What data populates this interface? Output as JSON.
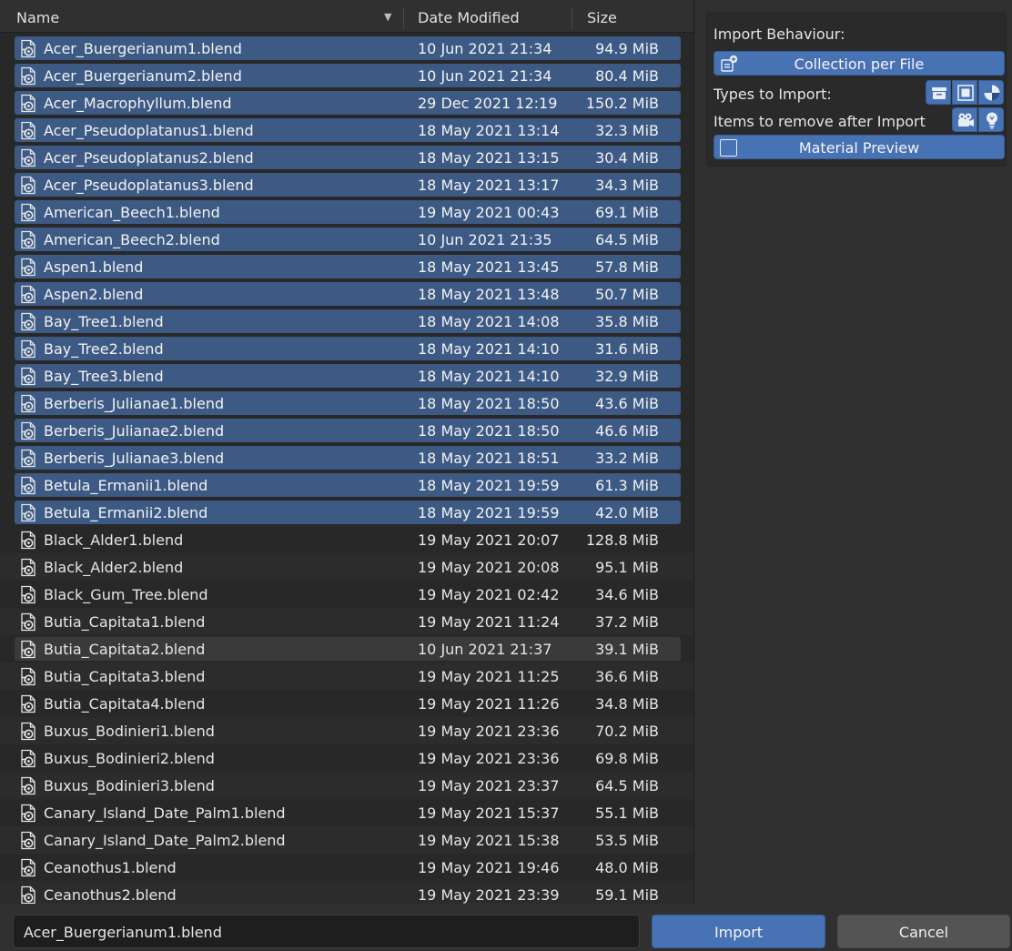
{
  "header": {
    "name_label": "Name",
    "sort_indicator": "▼",
    "date_label": "Date Modified",
    "size_label": "Size"
  },
  "files": [
    {
      "name": "Acer_Buergerianum1.blend",
      "date": "10 Jun 2021 21:34",
      "size": "94.9 MiB",
      "selected": true
    },
    {
      "name": "Acer_Buergerianum2.blend",
      "date": "10 Jun 2021 21:34",
      "size": "80.4 MiB",
      "selected": true
    },
    {
      "name": "Acer_Macrophyllum.blend",
      "date": "29 Dec 2021 12:19",
      "size": "150.2 MiB",
      "selected": true
    },
    {
      "name": "Acer_Pseudoplatanus1.blend",
      "date": "18 May 2021 13:14",
      "size": "32.3 MiB",
      "selected": true
    },
    {
      "name": "Acer_Pseudoplatanus2.blend",
      "date": "18 May 2021 13:15",
      "size": "30.4 MiB",
      "selected": true
    },
    {
      "name": "Acer_Pseudoplatanus3.blend",
      "date": "18 May 2021 13:17",
      "size": "34.3 MiB",
      "selected": true
    },
    {
      "name": "American_Beech1.blend",
      "date": "19 May 2021 00:43",
      "size": "69.1 MiB",
      "selected": true
    },
    {
      "name": "American_Beech2.blend",
      "date": "10 Jun 2021 21:35",
      "size": "64.5 MiB",
      "selected": true
    },
    {
      "name": "Aspen1.blend",
      "date": "18 May 2021 13:45",
      "size": "57.8 MiB",
      "selected": true
    },
    {
      "name": "Aspen2.blend",
      "date": "18 May 2021 13:48",
      "size": "50.7 MiB",
      "selected": true
    },
    {
      "name": "Bay_Tree1.blend",
      "date": "18 May 2021 14:08",
      "size": "35.8 MiB",
      "selected": true
    },
    {
      "name": "Bay_Tree2.blend",
      "date": "18 May 2021 14:10",
      "size": "31.6 MiB",
      "selected": true
    },
    {
      "name": "Bay_Tree3.blend",
      "date": "18 May 2021 14:10",
      "size": "32.9 MiB",
      "selected": true
    },
    {
      "name": "Berberis_Julianae1.blend",
      "date": "18 May 2021 18:50",
      "size": "43.6 MiB",
      "selected": true
    },
    {
      "name": "Berberis_Julianae2.blend",
      "date": "18 May 2021 18:50",
      "size": "46.6 MiB",
      "selected": true
    },
    {
      "name": "Berberis_Julianae3.blend",
      "date": "18 May 2021 18:51",
      "size": "33.2 MiB",
      "selected": true
    },
    {
      "name": "Betula_Ermanii1.blend",
      "date": "18 May 2021 19:59",
      "size": "61.3 MiB",
      "selected": true
    },
    {
      "name": "Betula_Ermanii2.blend",
      "date": "18 May 2021 19:59",
      "size": "42.0 MiB",
      "selected": true
    },
    {
      "name": "Black_Alder1.blend",
      "date": "19 May 2021 20:07",
      "size": "128.8 MiB",
      "selected": false
    },
    {
      "name": "Black_Alder2.blend",
      "date": "19 May 2021 20:08",
      "size": "95.1 MiB",
      "selected": false
    },
    {
      "name": "Black_Gum_Tree.blend",
      "date": "19 May 2021 02:42",
      "size": "34.6 MiB",
      "selected": false
    },
    {
      "name": "Butia_Capitata1.blend",
      "date": "19 May 2021 11:24",
      "size": "37.2 MiB",
      "selected": false
    },
    {
      "name": "Butia_Capitata2.blend",
      "date": "10 Jun 2021 21:37",
      "size": "39.1 MiB",
      "selected": false,
      "hover": true
    },
    {
      "name": "Butia_Capitata3.blend",
      "date": "19 May 2021 11:25",
      "size": "36.6 MiB",
      "selected": false
    },
    {
      "name": "Butia_Capitata4.blend",
      "date": "19 May 2021 11:26",
      "size": "34.8 MiB",
      "selected": false
    },
    {
      "name": "Buxus_Bodinieri1.blend",
      "date": "19 May 2021 23:36",
      "size": "70.2 MiB",
      "selected": false
    },
    {
      "name": "Buxus_Bodinieri2.blend",
      "date": "19 May 2021 23:36",
      "size": "69.8 MiB",
      "selected": false
    },
    {
      "name": "Buxus_Bodinieri3.blend",
      "date": "19 May 2021 23:37",
      "size": "64.5 MiB",
      "selected": false
    },
    {
      "name": "Canary_Island_Date_Palm1.blend",
      "date": "19 May 2021 15:37",
      "size": "55.1 MiB",
      "selected": false
    },
    {
      "name": "Canary_Island_Date_Palm2.blend",
      "date": "19 May 2021 15:38",
      "size": "53.5 MiB",
      "selected": false
    },
    {
      "name": "Ceanothus1.blend",
      "date": "19 May 2021 19:46",
      "size": "48.0 MiB",
      "selected": false
    },
    {
      "name": "Ceanothus2.blend",
      "date": "19 May 2021 23:39",
      "size": "59.1 MiB",
      "selected": false
    }
  ],
  "options": {
    "import_behaviour_label": "Import Behaviour:",
    "collection_button": "Collection per File",
    "types_label": "Types to Import:",
    "types_icons": [
      "collection-icon",
      "object-icon",
      "material-icon"
    ],
    "remove_label": "Items to remove after Import",
    "remove_icons": [
      "camera-icon",
      "light-icon"
    ],
    "material_preview_label": "Material Preview",
    "material_preview_checked": false
  },
  "footer": {
    "filename_value": "Acer_Buergerianum1.blend",
    "import_label": "Import",
    "cancel_label": "Cancel"
  },
  "colors": {
    "accent": "#4772b3",
    "selected_row": "#3d5a85",
    "background": "#303030",
    "list_background": "#282828"
  }
}
